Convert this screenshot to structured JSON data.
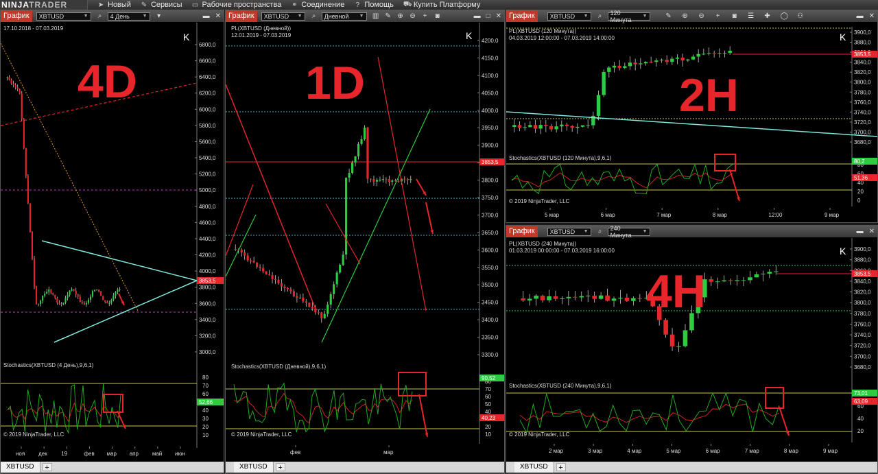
{
  "app": {
    "logo_left": "NINJA",
    "logo_right": "TRADER"
  },
  "menu": [
    {
      "label": "Новый",
      "icon": "arrow-icon"
    },
    {
      "label": "Сервисы",
      "icon": "wrench-icon"
    },
    {
      "label": "Рабочие пространства",
      "icon": "document-icon"
    },
    {
      "label": "Соединение",
      "icon": "connection-icon"
    },
    {
      "label": "Помощь",
      "icon": "help-icon"
    },
    {
      "label": "Купить Платформу",
      "icon": "cart-icon"
    }
  ],
  "windows": {
    "w4d": {
      "title": "График",
      "instrument": "XBTUSD",
      "timeframe": "4 День",
      "label": "4D",
      "range": "17.10.2018 - 07.03.2019",
      "price_axis": [
        "6800,0",
        "6600,0",
        "6400,0",
        "6200,0",
        "6000,0",
        "5800,0",
        "5600,0",
        "5400,0",
        "5200,0",
        "5000,0",
        "4800,0",
        "4600,0",
        "4400,0",
        "4200,0",
        "4000,0",
        "3800,0",
        "3600,0",
        "3400,0",
        "3200,0",
        "3000,0"
      ],
      "last_price": "3853,5",
      "stoch_title": "Stochastics(XBTUSD (4 День),9,6,1)",
      "stoch_axis": [
        "80",
        "70",
        "60",
        "50",
        "40",
        "30",
        "20",
        "10"
      ],
      "stoch_value": "52,66",
      "copyright": "© 2019 NinjaTrader, LLC",
      "date_axis": [
        "ноя",
        "дек",
        "19",
        "фев",
        "мар",
        "апр",
        "май",
        "июн"
      ],
      "tab": "XBTUSD"
    },
    "w1d": {
      "title": "График",
      "instrument": "XBTUSD",
      "timeframe": "Дневной",
      "label": "1D",
      "chart_title": "PL(XBTUSD (Дневной))",
      "range": "12.01.2019 - 07.03.2019",
      "price_axis": [
        "4200,0",
        "4150,0",
        "4100,0",
        "4050,0",
        "4000,0",
        "3950,0",
        "3900,0",
        "3850,0",
        "3800,0",
        "3750,0",
        "3700,0",
        "3650,0",
        "3600,0",
        "3550,0",
        "3500,0",
        "3450,0",
        "3400,0",
        "3350,0",
        "3300,0"
      ],
      "last_price": "3853,5",
      "stoch_title": "Stochastics(XBTUSD (Дневной),9,6,1)",
      "stoch_axis": [
        "80",
        "70",
        "60",
        "50",
        "40",
        "30",
        "20",
        "10"
      ],
      "stoch_value_1": "90,52",
      "stoch_value_2": "40,23",
      "copyright": "© 2019 NinjaTrader, LLC",
      "date_axis": [
        "фев",
        "мар"
      ],
      "tab": "XBTUSD"
    },
    "w2h": {
      "title": "График",
      "instrument": "XBTUSD",
      "timeframe": "120 Минута",
      "label": "2H",
      "chart_title": "PL(XBTUSD (120 Минута))",
      "range": "04.03.2019 12:00:00 - 07.03.2019 14:00:00",
      "price_axis": [
        "3900,0",
        "3880,0",
        "3860,0",
        "3840,0",
        "3820,0",
        "3800,0",
        "3780,0",
        "3760,0",
        "3740,0",
        "3720,0",
        "3700,0",
        "3680,0"
      ],
      "last_price": "3853,5",
      "stoch_title": "Stochastics(XBTUSD (120 Минута),9,6,1)",
      "stoch_axis": [
        "80",
        "60",
        "40",
        "20",
        "0"
      ],
      "stoch_value_1": "80,2",
      "stoch_value_2": "51,36",
      "copyright": "© 2019 NinjaTrader, LLC",
      "date_axis": [
        "5 мар",
        "6 мар",
        "7 мар",
        "8 мар",
        "12:00",
        "9 мар"
      ]
    },
    "w4h": {
      "title": "График",
      "instrument": "XBTUSD",
      "timeframe": "240 Минута",
      "label": "4H",
      "chart_title": "PL(XBTUSD (240 Минута))",
      "range": "01.03.2019 00:00:00 - 07.03.2019 16:00:00",
      "price_axis": [
        "3900,0",
        "3880,0",
        "3860,0",
        "3840,0",
        "3820,0",
        "3800,0",
        "3780,0",
        "3760,0",
        "3740,0",
        "3720,0",
        "3700,0",
        "3680,0"
      ],
      "last_price": "3853,5",
      "stoch_title": "Stochastics(XBTUSD (240 Минута),9,6,1)",
      "stoch_axis": [
        "80",
        "60",
        "40",
        "20"
      ],
      "stoch_value_1": "73,01",
      "stoch_value_2": "63,09",
      "copyright": "© 2019 NinjaTrader, LLC",
      "date_axis": [
        "2 мар",
        "3 мар",
        "4 мар",
        "5 мар",
        "6 мар",
        "7 мар",
        "8 мар",
        "9 мар"
      ],
      "tab": "XBTUSD"
    }
  },
  "colors": {
    "bull": "#2ecc40",
    "bear": "#e8252a",
    "accent": "#e8252a",
    "stoch_k": "#22aa22",
    "stoch_d": "#cc2222"
  }
}
